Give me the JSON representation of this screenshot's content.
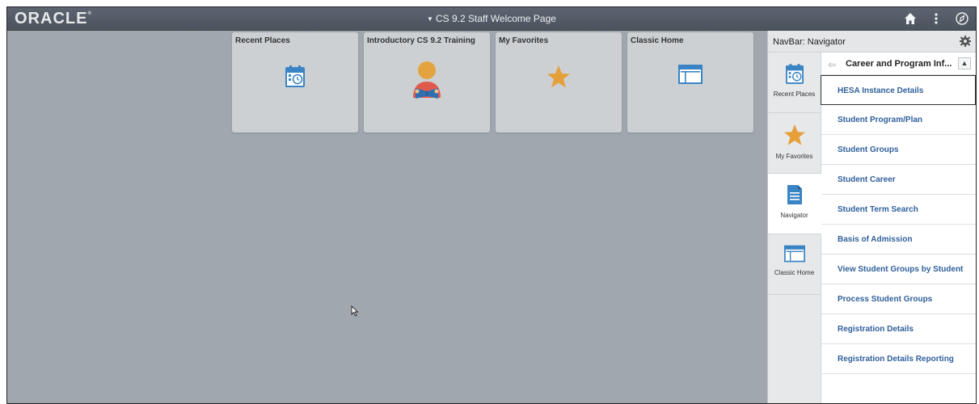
{
  "banner": {
    "logo": "ORACLE",
    "title": "CS 9.2 Staff Welcome Page",
    "icons": [
      "home-icon",
      "actions-menu-icon",
      "navbar-compass-icon"
    ]
  },
  "tiles": [
    {
      "title": "Recent Places",
      "icon": "calendar-clock-icon"
    },
    {
      "title": "Introductory CS 9.2 Training",
      "icon": "reader-person-icon"
    },
    {
      "title": "My Favorites",
      "icon": "star-icon"
    },
    {
      "title": "Classic Home",
      "icon": "window-icon"
    }
  ],
  "navbar": {
    "title": "NavBar: Navigator",
    "tabs": [
      {
        "label": "Recent Places",
        "icon": "calendar-clock-icon"
      },
      {
        "label": "My Favorites",
        "icon": "star-icon"
      },
      {
        "label": "Navigator",
        "icon": "document-icon",
        "active": true
      },
      {
        "label": "Classic Home",
        "icon": "window-icon"
      }
    ],
    "breadcrumb": "Career and Program Inf...",
    "items": [
      "HESA Instance Details",
      "Student Program/Plan",
      "Student Groups",
      "Student Career",
      "Student Term Search",
      "Basis of Admission",
      "View Student Groups by Student",
      "Process Student Groups",
      "Registration Details",
      "Registration Details Reporting"
    ]
  },
  "colors": {
    "banner": "#4f5862",
    "page_background": "#a0a7ae",
    "tile_background": "#cdd0d3",
    "link": "#2f5f9b",
    "star": "#e6a03a",
    "icon_blue": "#3a84c4"
  }
}
